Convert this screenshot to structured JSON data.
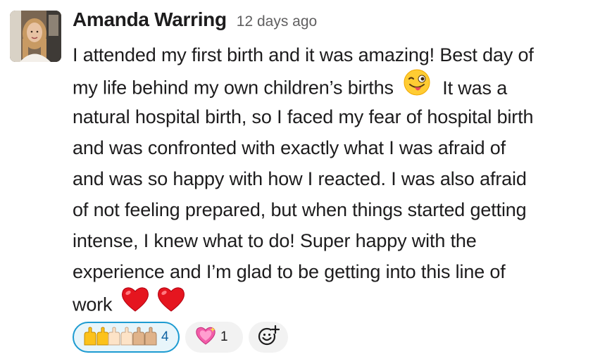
{
  "message": {
    "author": "Amanda Warring",
    "timestamp": "12 days ago",
    "lines": [
      "I attended my first birth and it was amazing! Best day of",
      "my life behind my own children’s births",
      "It was a",
      "natural hospital birth, so I faced my fear of hospital birth",
      "and was confronted with exactly what I was afraid of",
      "and was so happy with how I reacted. I was also afraid",
      "of not feeling prepared, but when things started getting",
      "intense, I knew what to do! Super happy with the",
      "experience and I’m glad to be getting into this line of",
      "work"
    ],
    "inline_emojis": [
      "winking-face-with-tongue-emoji",
      "red-heart-emoji",
      "red-heart-emoji"
    ]
  },
  "reactions": [
    {
      "emoji": "raising-hands-emoji",
      "count": "4",
      "selected": true
    },
    {
      "emoji": "sparkling-heart-emoji",
      "count": "1",
      "selected": false
    }
  ],
  "add_reaction_icon": "add-reaction-icon",
  "colors": {
    "text": "#1d1c1d",
    "timestamp": "#616061",
    "reaction_bg": "#f2f2f2",
    "reaction_selected_border": "#1d9bd1",
    "reaction_selected_bg": "#e8f5fa",
    "reaction_selected_count": "#1264a3"
  }
}
